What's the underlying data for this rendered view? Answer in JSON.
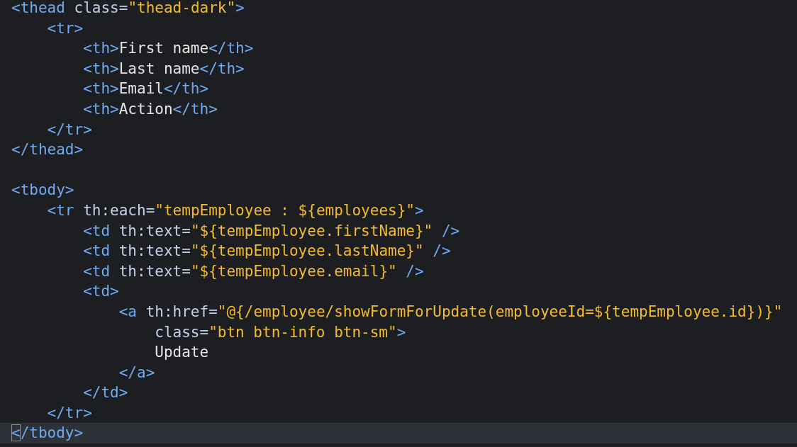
{
  "editor": {
    "lines": [
      {
        "current": false,
        "tokens": [
          {
            "kind": "tag",
            "text": "<thead"
          },
          {
            "kind": "attr",
            "text": " class="
          },
          {
            "kind": "string",
            "text": "\"thead-dark\""
          },
          {
            "kind": "tag",
            "text": ">"
          }
        ]
      },
      {
        "current": false,
        "tokens": [
          {
            "kind": "tag",
            "text": "    <tr>"
          }
        ]
      },
      {
        "current": false,
        "tokens": [
          {
            "kind": "tag",
            "text": "        <th>"
          },
          {
            "kind": "text",
            "text": "First name"
          },
          {
            "kind": "tag",
            "text": "</th>"
          }
        ]
      },
      {
        "current": false,
        "tokens": [
          {
            "kind": "tag",
            "text": "        <th>"
          },
          {
            "kind": "text",
            "text": "Last name"
          },
          {
            "kind": "tag",
            "text": "</th>"
          }
        ]
      },
      {
        "current": false,
        "tokens": [
          {
            "kind": "tag",
            "text": "        <th>"
          },
          {
            "kind": "text",
            "text": "Email"
          },
          {
            "kind": "tag",
            "text": "</th>"
          }
        ]
      },
      {
        "current": false,
        "tokens": [
          {
            "kind": "tag",
            "text": "        <th>"
          },
          {
            "kind": "text",
            "text": "Action"
          },
          {
            "kind": "tag",
            "text": "</th>"
          }
        ]
      },
      {
        "current": false,
        "tokens": [
          {
            "kind": "tag",
            "text": "    </tr>"
          }
        ]
      },
      {
        "current": false,
        "tokens": [
          {
            "kind": "tag",
            "text": "</thead>"
          }
        ]
      },
      {
        "current": false
      },
      {
        "current": false,
        "tokens": [
          {
            "kind": "tag",
            "text": "<tbody>"
          }
        ]
      },
      {
        "current": false,
        "tokens": [
          {
            "kind": "tag",
            "text": "    <tr"
          },
          {
            "kind": "attr",
            "text": " th:each="
          },
          {
            "kind": "string",
            "text": "\"tempEmployee : ${employees}\""
          },
          {
            "kind": "tag",
            "text": ">"
          }
        ]
      },
      {
        "current": false,
        "tokens": [
          {
            "kind": "tag",
            "text": "        <td"
          },
          {
            "kind": "attr",
            "text": " th:text="
          },
          {
            "kind": "string",
            "text": "\"${tempEmployee.firstName}\""
          },
          {
            "kind": "tag",
            "text": " />"
          }
        ]
      },
      {
        "current": false,
        "tokens": [
          {
            "kind": "tag",
            "text": "        <td"
          },
          {
            "kind": "attr",
            "text": " th:text="
          },
          {
            "kind": "string",
            "text": "\"${tempEmployee.lastName}\""
          },
          {
            "kind": "tag",
            "text": " />"
          }
        ]
      },
      {
        "current": false,
        "tokens": [
          {
            "kind": "tag",
            "text": "        <td"
          },
          {
            "kind": "attr",
            "text": " th:text="
          },
          {
            "kind": "string",
            "text": "\"${tempEmployee.email}\""
          },
          {
            "kind": "tag",
            "text": " />"
          }
        ]
      },
      {
        "current": false,
        "tokens": [
          {
            "kind": "tag",
            "text": "        <td>"
          }
        ]
      },
      {
        "current": false,
        "tokens": [
          {
            "kind": "tag",
            "text": "            <a"
          },
          {
            "kind": "attr",
            "text": " th:href="
          },
          {
            "kind": "string",
            "text": "\"@{/employee/showFormForUpdate(employeeId=${tempEmployee.id})}\""
          }
        ]
      },
      {
        "current": false,
        "tokens": [
          {
            "kind": "attr",
            "text": "                class="
          },
          {
            "kind": "string",
            "text": "\"btn btn-info btn-sm\""
          },
          {
            "kind": "tag",
            "text": ">"
          }
        ]
      },
      {
        "current": false,
        "tokens": [
          {
            "kind": "text",
            "text": "                Update"
          }
        ]
      },
      {
        "current": false,
        "tokens": [
          {
            "kind": "tag",
            "text": "            </a>"
          }
        ]
      },
      {
        "current": false,
        "tokens": [
          {
            "kind": "tag",
            "text": "        </td>"
          }
        ]
      },
      {
        "current": false,
        "tokens": [
          {
            "kind": "tag",
            "text": "    </tr>"
          }
        ]
      },
      {
        "current": true,
        "tokens": [
          {
            "kind": "tag",
            "text": "</tbody>"
          }
        ]
      }
    ]
  }
}
